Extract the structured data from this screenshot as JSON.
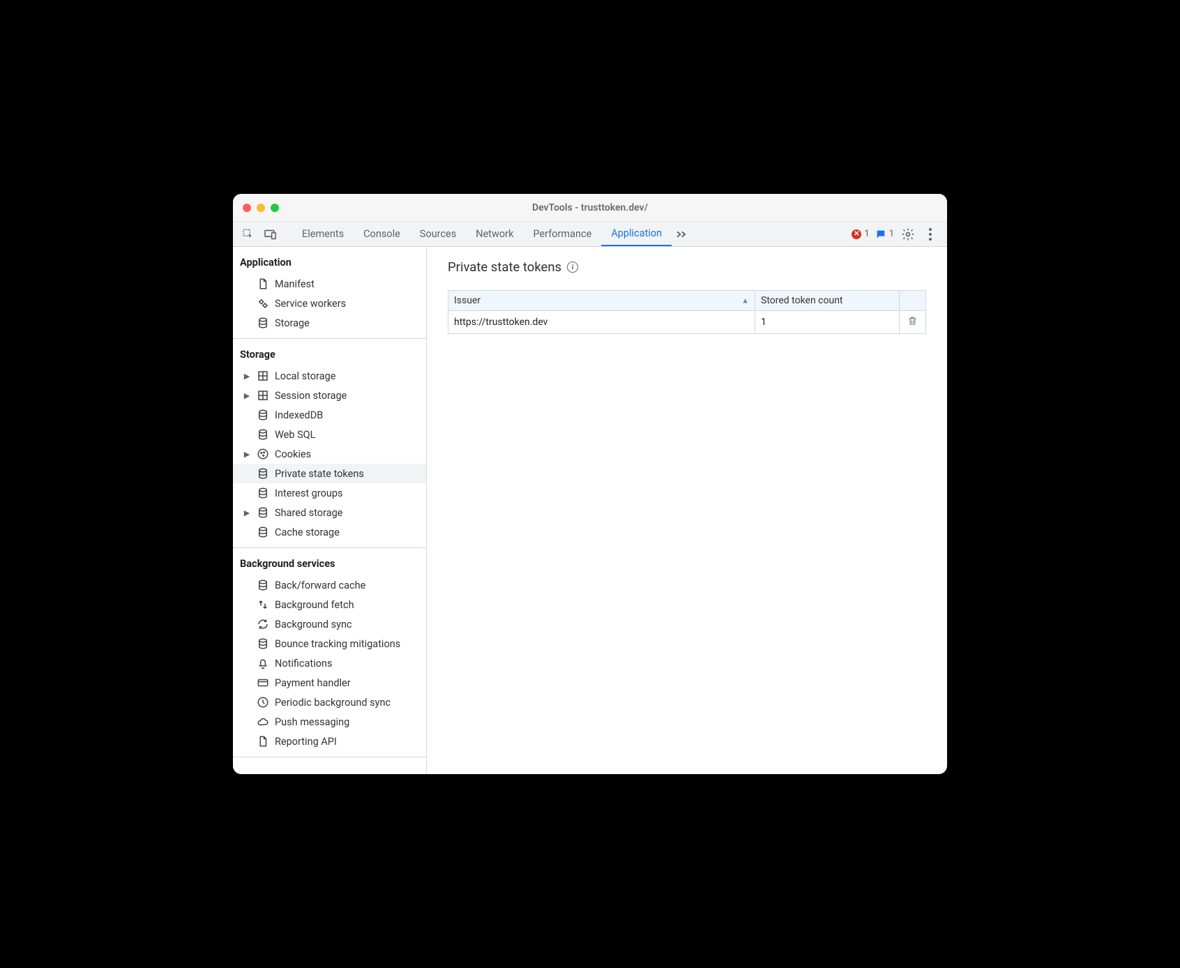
{
  "window": {
    "title": "DevTools - trusttoken.dev/"
  },
  "tabs": {
    "items": [
      "Elements",
      "Console",
      "Sources",
      "Network",
      "Performance",
      "Application"
    ],
    "active": "Application"
  },
  "statusbar": {
    "error_count": "1",
    "message_count": "1"
  },
  "sidebar": {
    "sections": [
      {
        "title": "Application",
        "items": [
          {
            "label": "Manifest",
            "icon": "file-icon",
            "expand": false
          },
          {
            "label": "Service workers",
            "icon": "gears-icon",
            "expand": false
          },
          {
            "label": "Storage",
            "icon": "storage-icon",
            "expand": false
          }
        ]
      },
      {
        "title": "Storage",
        "items": [
          {
            "label": "Local storage",
            "icon": "grid-icon",
            "expand": true
          },
          {
            "label": "Session storage",
            "icon": "grid-icon",
            "expand": true
          },
          {
            "label": "IndexedDB",
            "icon": "storage-icon",
            "expand": false
          },
          {
            "label": "Web SQL",
            "icon": "storage-icon",
            "expand": false
          },
          {
            "label": "Cookies",
            "icon": "cookie-icon",
            "expand": true
          },
          {
            "label": "Private state tokens",
            "icon": "storage-icon",
            "expand": false,
            "selected": true
          },
          {
            "label": "Interest groups",
            "icon": "storage-icon",
            "expand": false
          },
          {
            "label": "Shared storage",
            "icon": "storage-icon",
            "expand": true
          },
          {
            "label": "Cache storage",
            "icon": "storage-icon",
            "expand": false
          }
        ]
      },
      {
        "title": "Background services",
        "items": [
          {
            "label": "Back/forward cache",
            "icon": "storage-icon",
            "expand": false
          },
          {
            "label": "Background fetch",
            "icon": "updown-icon",
            "expand": false
          },
          {
            "label": "Background sync",
            "icon": "sync-icon",
            "expand": false
          },
          {
            "label": "Bounce tracking mitigations",
            "icon": "storage-icon",
            "expand": false
          },
          {
            "label": "Notifications",
            "icon": "bell-icon",
            "expand": false
          },
          {
            "label": "Payment handler",
            "icon": "card-icon",
            "expand": false
          },
          {
            "label": "Periodic background sync",
            "icon": "clock-icon",
            "expand": false
          },
          {
            "label": "Push messaging",
            "icon": "cloud-icon",
            "expand": false
          },
          {
            "label": "Reporting API",
            "icon": "file-icon",
            "expand": false
          }
        ]
      }
    ]
  },
  "main": {
    "heading": "Private state tokens",
    "table": {
      "columns": [
        "Issuer",
        "Stored token count"
      ],
      "rows": [
        {
          "issuer": "https://trusttoken.dev",
          "count": "1"
        }
      ]
    }
  }
}
